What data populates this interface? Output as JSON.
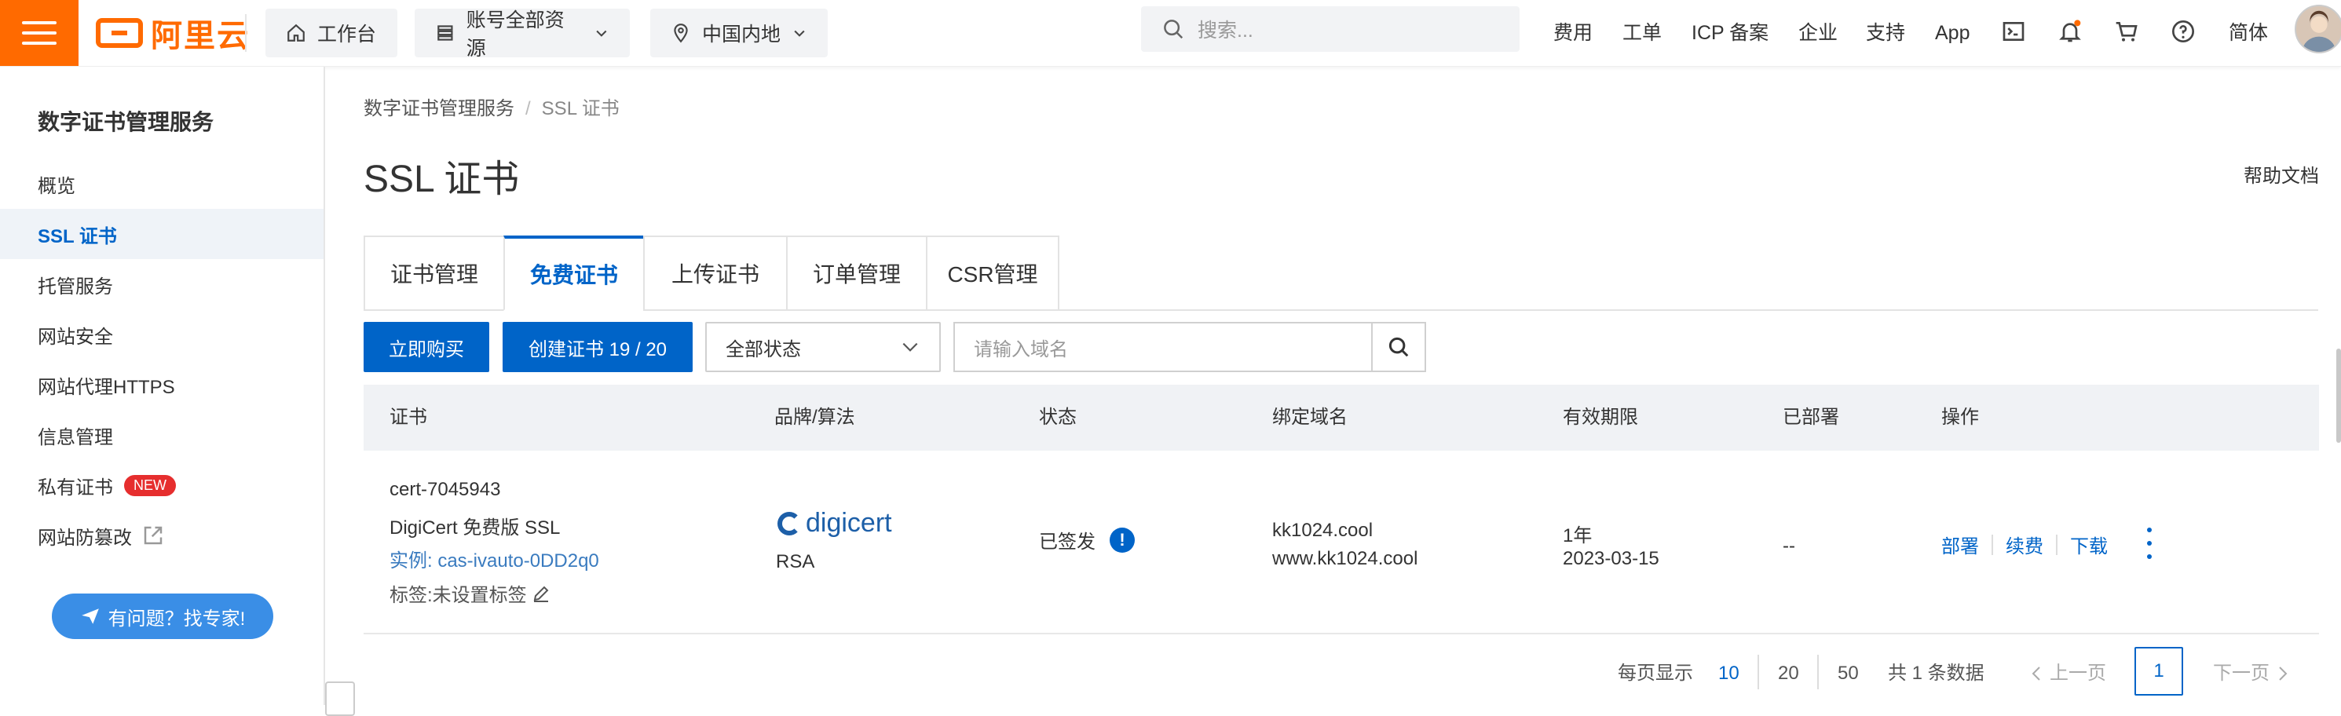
{
  "topbar": {
    "logo_text": "阿里云",
    "workbench": "工作台",
    "resources": "账号全部资源",
    "region": "中国内地",
    "search_placeholder": "搜索...",
    "nav": [
      "费用",
      "工单",
      "ICP 备案",
      "企业",
      "支持",
      "App"
    ],
    "lang": "简体",
    "icons": [
      "terminal-icon",
      "bell-icon",
      "cart-icon",
      "help-icon"
    ],
    "brand_color": "#ff6a00"
  },
  "sidebar": {
    "title": "数字证书管理服务",
    "items": [
      {
        "label": "概览"
      },
      {
        "label": "SSL 证书",
        "active": true
      },
      {
        "label": "托管服务"
      },
      {
        "label": "网站安全"
      },
      {
        "label": "网站代理HTTPS"
      },
      {
        "label": "信息管理"
      },
      {
        "label": "私有证书",
        "badge": "NEW"
      },
      {
        "label": "网站防篡改",
        "external": true
      }
    ],
    "help_button": "有问题？找专家!"
  },
  "main": {
    "breadcrumb": [
      "数字证书管理服务",
      "SSL 证书"
    ],
    "title": "SSL 证书",
    "help_doc": "帮助文档",
    "tabs": [
      "证书管理",
      "免费证书",
      "上传证书",
      "订单管理",
      "CSR管理"
    ],
    "active_tab": "免费证书",
    "toolbar": {
      "buy": "立即购买",
      "create": "创建证书 19 / 20",
      "status_select": "全部状态",
      "domain_placeholder": "请输入域名"
    },
    "table": {
      "headers": [
        "证书",
        "品牌/算法",
        "状态",
        "绑定域名",
        "有效期限",
        "已部署",
        "操作"
      ],
      "rows": [
        {
          "cert_id": "cert-7045943",
          "cert_name": "DigiCert 免费版 SSL",
          "instance": "实例: cas-ivauto-0DD2q0",
          "tag": "标签:未设置标签",
          "brand": "digicert",
          "algorithm": "RSA",
          "status": "已签发",
          "domains": [
            "kk1024.cool",
            "www.kk1024.cool"
          ],
          "validity": "1年",
          "expiry": "2023-03-15",
          "deployed": "--",
          "actions": [
            "部署",
            "续费",
            "下载"
          ]
        }
      ]
    },
    "pagination": {
      "page_size_label": "每页显示",
      "sizes": [
        "10",
        "20",
        "50"
      ],
      "active_size": "10",
      "total": "共 1 条数据",
      "prev": "上一页",
      "current": "1",
      "next": "下一页"
    }
  },
  "colors": {
    "primary": "#0064c8",
    "accent": "#ff6a00"
  }
}
